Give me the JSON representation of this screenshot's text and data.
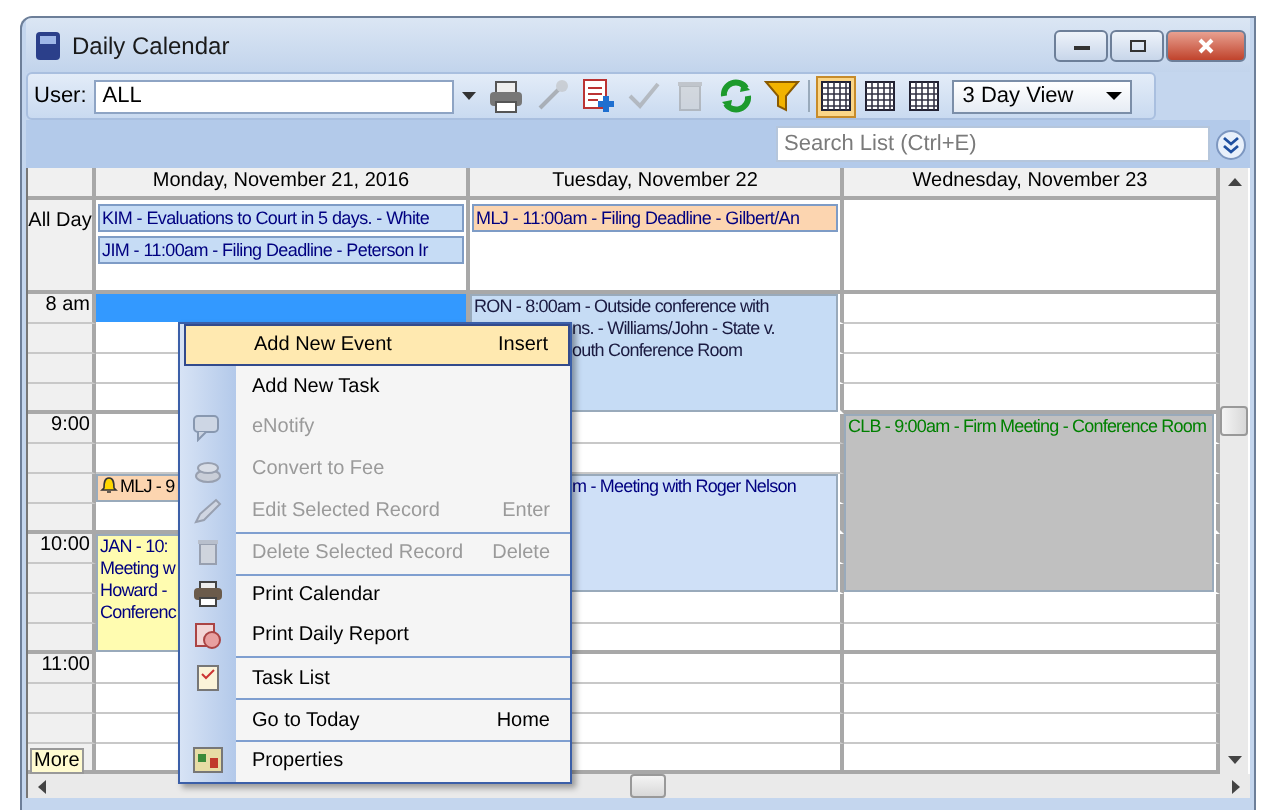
{
  "window": {
    "title": "Daily Calendar"
  },
  "toolbar": {
    "user_label": "User:",
    "user_value": "ALL",
    "tools": [
      {
        "disabled": false
      },
      {
        "disabled": true
      },
      {
        "disabled": false
      },
      {
        "disabled": true
      },
      {
        "disabled": true
      },
      {
        "disabled": false
      },
      {
        "disabled": false
      }
    ],
    "views": [
      {
        "selected": true
      },
      {
        "selected": false
      },
      {
        "selected": false
      }
    ],
    "view_select": "3 Day View"
  },
  "search": {
    "placeholder": "Search List (Ctrl+E)"
  },
  "calendar": {
    "all_day_label": "All Day",
    "hours": [
      {
        "label": "8 am"
      },
      {
        "label": "9:00"
      },
      {
        "label": "10:00"
      },
      {
        "label": "11:00"
      }
    ],
    "more_button": "More",
    "days": [
      {
        "title": "Monday, November 21, 2016",
        "selection": true,
        "all_day": [
          {
            "text": "KIM - Evaluations to Court in 5 days. - White",
            "color": "#c6dcf5"
          },
          {
            "text": "JIM - 11:00am - Filing Deadline - Peterson Ir",
            "color": "#c6dcf5"
          }
        ],
        "events": [
          {
            "alarm": true,
            "lines": [
              "MLJ - 9"
            ],
            "color": "#fcd5b0"
          },
          {
            "lines": [
              "JAN - 10:",
              "Meeting w",
              "Howard -",
              "Conferenc"
            ],
            "color": "#fffcb0"
          }
        ]
      },
      {
        "title": "Tuesday, November 22",
        "all_day": [
          {
            "text": "MLJ - 11:00am - Filing Deadline - Gilbert/An",
            "color": "#fcd5b0"
          }
        ],
        "events": [
          {
            "lines": [
              "RON - 8:00am - Outside conference with",
              "ns. - Williams/John - State v.",
              "outh Conference Room"
            ],
            "color": "#c6dcf5"
          },
          {
            "lines": [
              "m - Meeting with Roger Nelson"
            ],
            "color": "#cfe0f7"
          }
        ]
      },
      {
        "title": "Wednesday, November 23",
        "events": [
          {
            "lines": [
              "CLB - 9:00am - Firm Meeting - Conference Room"
            ],
            "color": "#c0c0c0"
          }
        ]
      }
    ]
  },
  "context_menu": [
    {
      "label": "Add New Event",
      "shortcut": "Insert",
      "selected": true,
      "disabled": false
    },
    {
      "label": "Add New Task",
      "selected": false,
      "disabled": false
    },
    {
      "label": "eNotify",
      "selected": false,
      "disabled": true
    },
    {
      "label": "Convert to Fee",
      "selected": false,
      "disabled": true
    },
    {
      "label": "Edit Selected Record",
      "shortcut": "Enter",
      "selected": false,
      "disabled": true
    },
    {
      "label": "Delete Selected Record",
      "shortcut": "Delete",
      "selected": false,
      "disabled": true
    },
    {
      "label": "Print Calendar",
      "selected": false,
      "disabled": false
    },
    {
      "label": "Print Daily Report",
      "selected": false,
      "disabled": false
    },
    {
      "label": "Task List",
      "selected": false,
      "disabled": false
    },
    {
      "label": "Go to Today",
      "shortcut": "Home",
      "selected": false,
      "disabled": false
    },
    {
      "label": "Properties",
      "selected": false,
      "disabled": false
    }
  ]
}
